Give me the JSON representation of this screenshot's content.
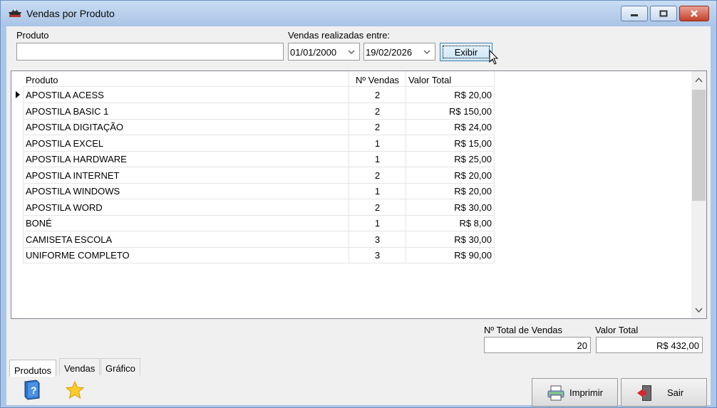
{
  "window": {
    "title": "Vendas por Produto"
  },
  "filters": {
    "produto_label": "Produto",
    "produto_value": "",
    "periodo_label": "Vendas realizadas entre:",
    "data_inicio": "01/01/2000",
    "data_fim": "19/02/2026",
    "exibir_label": "Exibir"
  },
  "grid": {
    "columns": [
      "Produto",
      "Nº Vendas",
      "Valor Total"
    ],
    "rows": [
      {
        "produto": "APOSTILA ACESS",
        "vendas": "2",
        "valor": "R$ 20,00"
      },
      {
        "produto": "APOSTILA BASIC 1",
        "vendas": "2",
        "valor": "R$ 150,00"
      },
      {
        "produto": "APOSTILA DIGITAÇÃO",
        "vendas": "2",
        "valor": "R$ 24,00"
      },
      {
        "produto": "APOSTILA EXCEL",
        "vendas": "1",
        "valor": "R$ 15,00"
      },
      {
        "produto": "APOSTILA HARDWARE",
        "vendas": "1",
        "valor": "R$ 25,00"
      },
      {
        "produto": "APOSTILA INTERNET",
        "vendas": "2",
        "valor": "R$ 20,00"
      },
      {
        "produto": "APOSTILA WINDOWS",
        "vendas": "1",
        "valor": "R$ 20,00"
      },
      {
        "produto": "APOSTILA WORD",
        "vendas": "2",
        "valor": "R$ 30,00"
      },
      {
        "produto": "BONÉ",
        "vendas": "1",
        "valor": "R$ 8,00"
      },
      {
        "produto": "CAMISETA ESCOLA",
        "vendas": "3",
        "valor": "R$ 30,00"
      },
      {
        "produto": "UNIFORME COMPLETO",
        "vendas": "3",
        "valor": "R$ 90,00"
      }
    ]
  },
  "totals": {
    "total_vendas_label": "Nº Total de Vendas",
    "total_vendas_value": "20",
    "valor_total_label": "Valor Total",
    "valor_total_value": "R$ 432,00"
  },
  "tabs": [
    "Produtos",
    "Vendas",
    "Gráfico"
  ],
  "actions": {
    "imprimir_label": "Imprimir",
    "sair_label": "Sair"
  },
  "icons": {
    "app": "pirate-hat-icon",
    "help": "help-book-icon",
    "favorite": "star-icon",
    "print": "printer-icon",
    "exit": "exit-door-icon"
  },
  "colors": {
    "titlebar": "#a9c4e6",
    "close_button": "#c4412b",
    "exibir_button": "#cde6f8"
  }
}
